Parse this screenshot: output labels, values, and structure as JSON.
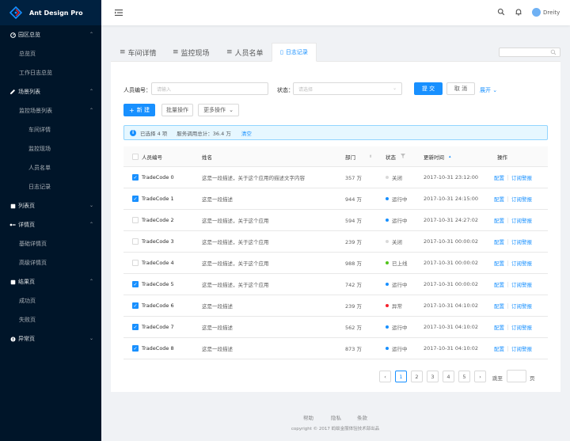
{
  "brand": {
    "title": "Ant Design Pro"
  },
  "sidebar": {
    "items": [
      {
        "label": "园区总览",
        "level": 1,
        "icon": "dashboard-icon",
        "arrow": "⌃"
      },
      {
        "label": "总览页",
        "level": 2
      },
      {
        "label": "工作日志总览",
        "level": 2
      },
      {
        "label": "场景列表",
        "level": 1,
        "icon": "form-icon",
        "arrow": "⌃"
      },
      {
        "label": "监控场景列表",
        "level": 2,
        "arrow": "⌃"
      },
      {
        "label": "车间详情",
        "level": 3
      },
      {
        "label": "监控现场",
        "level": 3
      },
      {
        "label": "人员名单",
        "level": 3
      },
      {
        "label": "日志记录",
        "level": 3
      },
      {
        "label": "列表页",
        "level": 1,
        "icon": "table-icon",
        "arrow": "⌄"
      },
      {
        "label": "详情页",
        "level": 1,
        "icon": "profile-icon",
        "arrow": "⌃"
      },
      {
        "label": "基础详情页",
        "level": 2
      },
      {
        "label": "高级详情页",
        "level": 2
      },
      {
        "label": "结果页",
        "level": 1,
        "icon": "check-circle-icon",
        "arrow": "⌃"
      },
      {
        "label": "成功页",
        "level": 2
      },
      {
        "label": "失败页",
        "level": 2
      },
      {
        "label": "异常页",
        "level": 1,
        "icon": "warning-icon",
        "arrow": "⌄"
      }
    ]
  },
  "header": {
    "username": "Dreity"
  },
  "tabs": [
    {
      "label": "车间详情",
      "icon": "≡"
    },
    {
      "label": "监控现场",
      "icon": "≡"
    },
    {
      "label": "人员名单",
      "icon": "≡"
    },
    {
      "label": "日志记录",
      "icon": "▯",
      "active": true
    }
  ],
  "form": {
    "member_label": "人员编号：",
    "member_placeholder": "请输入",
    "status_label": "状态：",
    "status_placeholder": "请选择",
    "submit": "提 交",
    "reset": "取 消",
    "expand": "展开"
  },
  "toolbar": {
    "new": "新 建",
    "batch": "批量操作",
    "more": "更多操作"
  },
  "alert": {
    "selected": "已选择 4 项",
    "total": "服务调用总计：36.4 万",
    "clear": "清空"
  },
  "table": {
    "columns": [
      "人员编号",
      "姓名",
      "部门",
      "状态",
      "更新时间",
      "操作"
    ],
    "rows": [
      {
        "checked": true,
        "code": "TradeCode 0",
        "name": "这是一段描述，关于这个应用的描述文字内容",
        "dept": "357 万",
        "status": "关闭",
        "status_color": "#d9d9d9",
        "time": "2017-10-31  23:12:00",
        "actions": [
          "配置",
          "订阅警报"
        ]
      },
      {
        "checked": true,
        "code": "TradeCode 1",
        "name": "这是一段描述",
        "dept": "944 万",
        "status": "运行中",
        "status_color": "#1890ff",
        "time": "2017-10-31  24:15:00",
        "actions": [
          "配置",
          "订阅警报"
        ]
      },
      {
        "checked": false,
        "code": "TradeCode 2",
        "name": "这是一段描述，关于这个应用",
        "dept": "594 万",
        "status": "运行中",
        "status_color": "#1890ff",
        "time": "2017-10-31  24:27:02",
        "actions": [
          "配置",
          "订阅警报"
        ]
      },
      {
        "checked": false,
        "code": "TradeCode 3",
        "name": "这是一段描述，关于这个应用",
        "dept": "239 万",
        "status": "关闭",
        "status_color": "#d9d9d9",
        "time": "2017-10-31  00:00:02",
        "actions": [
          "配置",
          "订阅警报"
        ]
      },
      {
        "checked": false,
        "code": "TradeCode 4",
        "name": "这是一段描述，关于这个应用",
        "dept": "988 万",
        "status": "已上线",
        "status_color": "#52c41a",
        "time": "2017-10-31  00:00:02",
        "actions": [
          "配置",
          "订阅警报"
        ]
      },
      {
        "checked": true,
        "code": "TradeCode 5",
        "name": "这是一段描述，关于这个应用",
        "dept": "742 万",
        "status": "运行中",
        "status_color": "#1890ff",
        "time": "2017-10-31  00:00:02",
        "actions": [
          "配置",
          "订阅警报"
        ]
      },
      {
        "checked": true,
        "code": "TradeCode 6",
        "name": "这是一段描述",
        "dept": "239 万",
        "status": "异常",
        "status_color": "#f5222d",
        "time": "2017-10-31  04:10:02",
        "actions": [
          "配置",
          "订阅警报"
        ]
      },
      {
        "checked": true,
        "code": "TradeCode 7",
        "name": "这是一段描述",
        "dept": "562 万",
        "status": "运行中",
        "status_color": "#1890ff",
        "time": "2017-10-31  04:10:02",
        "actions": [
          "配置",
          "订阅警报"
        ]
      },
      {
        "checked": true,
        "code": "TradeCode 8",
        "name": "这是一段描述",
        "dept": "873 万",
        "status": "运行中",
        "status_color": "#1890ff",
        "time": "2017-10-31  04:10:02",
        "actions": [
          "配置",
          "订阅警报"
        ]
      }
    ]
  },
  "pagination": {
    "prev": "‹",
    "next": "›",
    "pages": [
      "1",
      "2",
      "3",
      "4",
      "5"
    ],
    "current": "1",
    "goto_label": "跳至",
    "goto_unit": "页"
  },
  "footer": {
    "links": [
      "帮助",
      "隐私",
      "条款"
    ],
    "copyright": "copyright © 2017 蚂蚁金服体验技术部出品"
  },
  "colors": {
    "primary": "#1890ff",
    "sider": "#001529",
    "logo_bg": "#002140"
  }
}
